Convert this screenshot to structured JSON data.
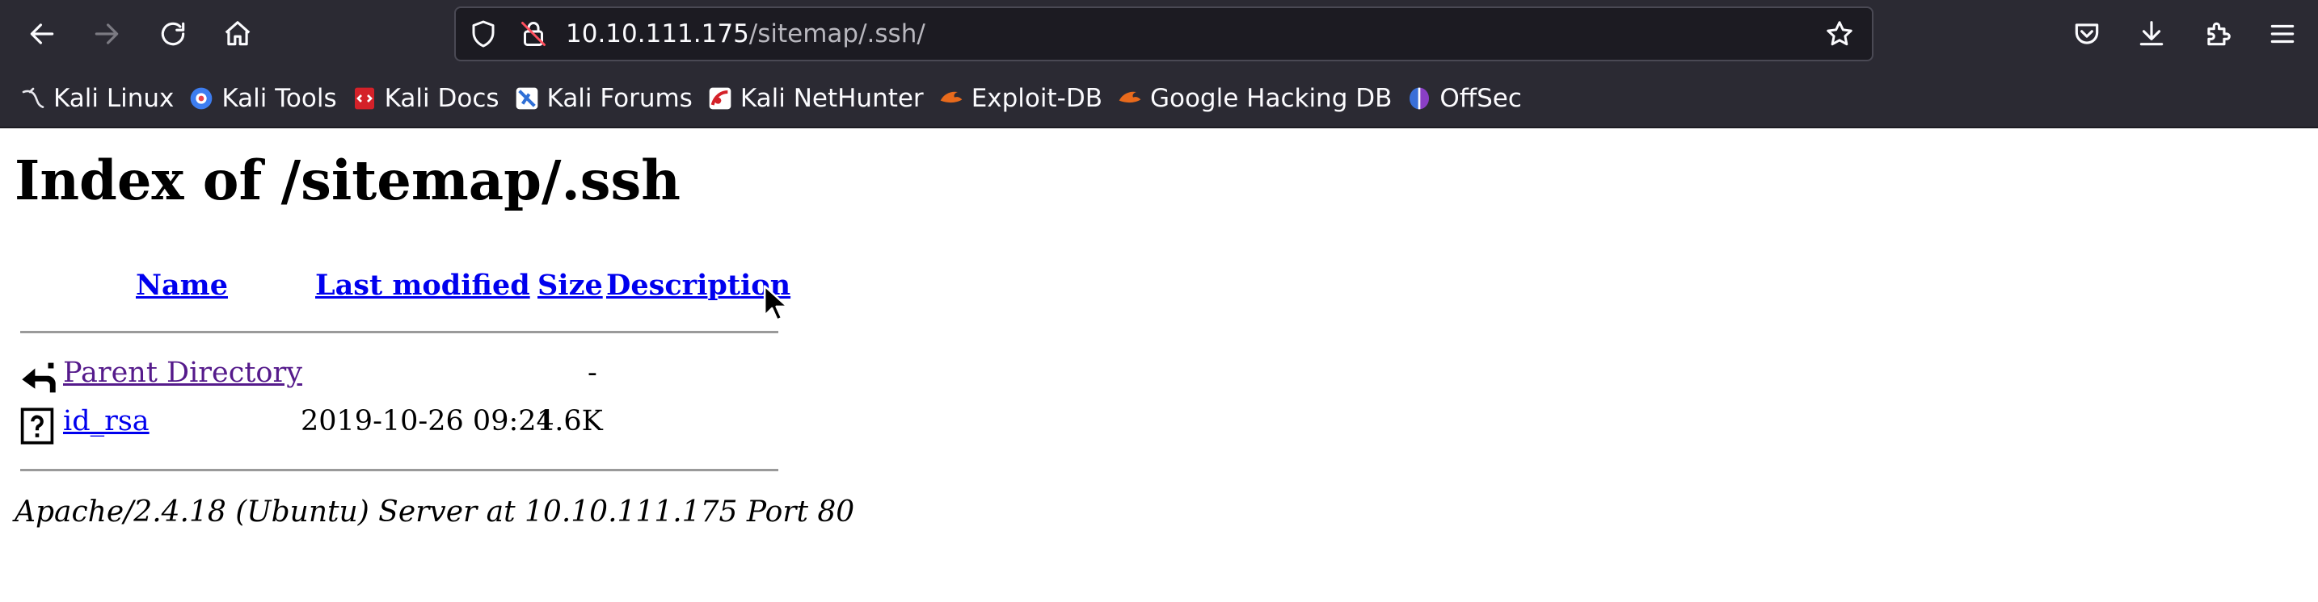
{
  "browser": {
    "url_host": "10.10.111.175",
    "url_path": "/sitemap/.ssh/",
    "nav_icons": [
      "back-arrow-icon",
      "forward-arrow-icon",
      "reload-icon",
      "home-icon"
    ],
    "right_icons": [
      "pocket-icon",
      "download-icon",
      "extensions-icon",
      "menu-icon"
    ],
    "bookmarks": [
      {
        "label": "Kali Linux",
        "icon": "kali-dragon-icon"
      },
      {
        "label": "Kali Tools",
        "icon": "kali-tools-icon"
      },
      {
        "label": "Kali Docs",
        "icon": "kali-docs-icon"
      },
      {
        "label": "Kali Forums",
        "icon": "kali-forums-icon"
      },
      {
        "label": "Kali NetHunter",
        "icon": "kali-nethunter-icon"
      },
      {
        "label": "Exploit-DB",
        "icon": "exploit-db-icon"
      },
      {
        "label": "Google Hacking DB",
        "icon": "google-hacking-db-icon"
      },
      {
        "label": "OffSec",
        "icon": "offsec-icon"
      }
    ],
    "colors": {
      "chrome_bg": "#2b2a33",
      "urlbar_bg": "#1c1b22",
      "text": "#fbfbfe"
    }
  },
  "page": {
    "title": "Index of /sitemap/.ssh",
    "columns": {
      "name": "Name",
      "last_modified": "Last modified",
      "size": "Size",
      "description": "Description"
    },
    "rows": [
      {
        "name": "Parent Directory",
        "last_modified": "",
        "size": "-",
        "description": "",
        "icon": "back-folder-icon"
      },
      {
        "name": "id_rsa",
        "last_modified": "2019-10-26 09:24",
        "size": "1.6K",
        "description": "",
        "icon": "unknown-file-icon"
      }
    ],
    "server_signature": "Apache/2.4.18 (Ubuntu) Server at 10.10.111.175 Port 80",
    "colors": {
      "link": "#0000ee",
      "visited_link": "#551a8b"
    }
  }
}
